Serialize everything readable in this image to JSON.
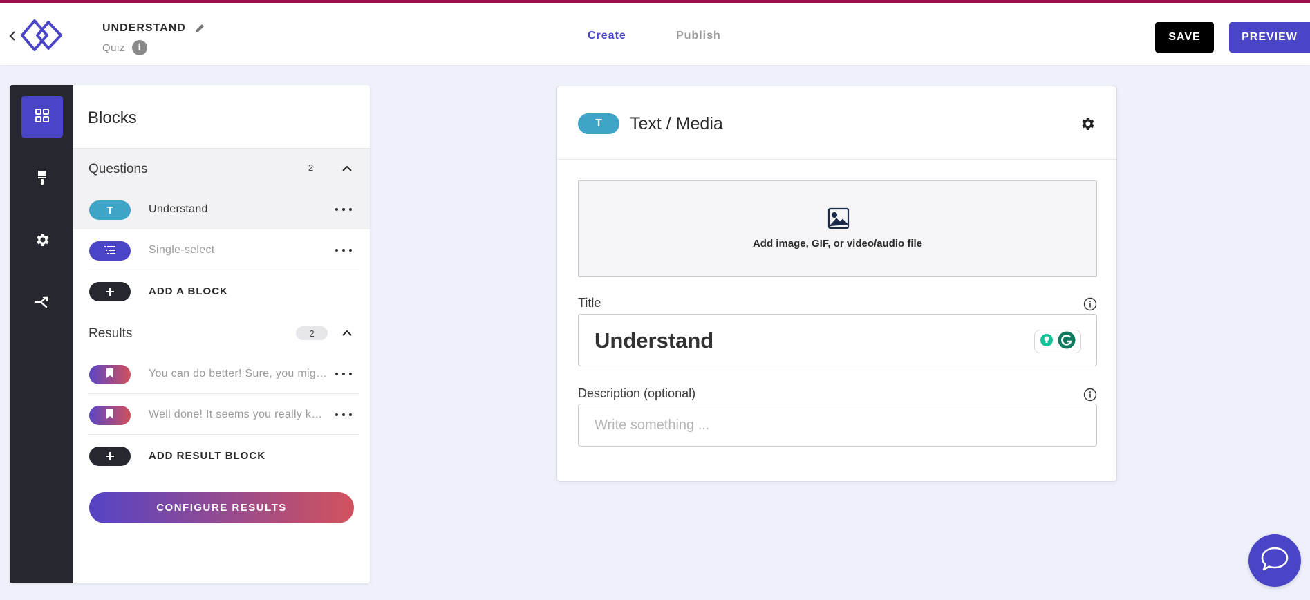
{
  "header": {
    "project_title": "UNDERSTAND",
    "project_type": "Quiz",
    "info_glyph": "i",
    "tabs": [
      {
        "label": "Create",
        "active": true
      },
      {
        "label": "Publish",
        "active": false
      }
    ],
    "save_label": "SAVE",
    "preview_label": "PREVIEW"
  },
  "colors": {
    "accent": "#4a44c6",
    "top_border": "#a0104e",
    "rail": "#27272f",
    "text_pill": "#3fa4c8",
    "gradient_start": "#5444c4",
    "gradient_end": "#d2525e"
  },
  "rail": {
    "items": [
      {
        "icon": "grid-icon",
        "active": true
      },
      {
        "icon": "paint-brush-icon",
        "active": false
      },
      {
        "icon": "gear-icon",
        "active": false
      },
      {
        "icon": "branch-icon",
        "active": false
      }
    ]
  },
  "blocks_panel": {
    "title": "Blocks",
    "questions": {
      "label": "Questions",
      "count": "2",
      "items": [
        {
          "pill": "T",
          "label": "Understand",
          "icon": "text-icon",
          "selected": true
        },
        {
          "pill": "",
          "label": "Single-select",
          "icon": "list-icon",
          "selected": false
        }
      ],
      "add_label": "ADD A BLOCK"
    },
    "results": {
      "label": "Results",
      "count": "2",
      "items": [
        {
          "label": "You can do better! Sure, you might not have understood everything",
          "icon": "bookmark-icon"
        },
        {
          "label": "Well done! It seems you really know what you are talking about",
          "icon": "bookmark-icon"
        }
      ],
      "add_label": "ADD RESULT BLOCK"
    },
    "configure_label": "CONFIGURE RESULTS"
  },
  "editor": {
    "block_pill": "T",
    "block_type": "Text / Media",
    "media_prompt": "Add image, GIF, or video/audio file",
    "title_label": "Title",
    "title_value": "Understand",
    "description_label": "Description (optional)",
    "description_placeholder": "Write something ..."
  }
}
